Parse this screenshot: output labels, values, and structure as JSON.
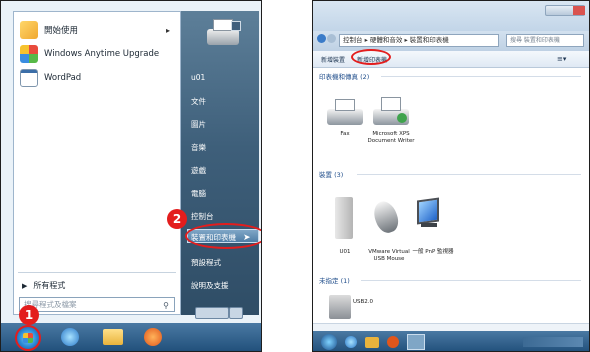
{
  "start_menu": {
    "programs": [
      {
        "label": "開始使用",
        "has_arrow": true,
        "icon": "getting-started-icon"
      },
      {
        "label": "Windows Anytime Upgrade",
        "has_arrow": false,
        "icon": "windows-upgrade-icon"
      },
      {
        "label": "WordPad",
        "has_arrow": false,
        "icon": "wordpad-icon"
      }
    ],
    "all_programs": "所有程式",
    "search_placeholder": "搜尋程式及檔案",
    "right_items": [
      "u01",
      "文件",
      "圖片",
      "音樂",
      "遊戲",
      "電腦",
      "控制台",
      "裝置和印表機",
      "預設程式",
      "說明及支援"
    ],
    "highlighted_item": "裝置和印表機"
  },
  "callouts": {
    "step1": "1",
    "step2": "2"
  },
  "devices_window": {
    "address": "控制台 ▸ 硬體和音效 ▸ 裝置和印表機",
    "search_placeholder": "搜尋 裝置和印表機",
    "commands": [
      "新增裝置",
      "新增印表機"
    ],
    "sections": {
      "printers": "印表機和傳真 (2)",
      "devices": "裝置 (3)",
      "unspecified": "未指定 (1)"
    },
    "printers": [
      {
        "label": "Fax"
      },
      {
        "label": "Microsoft XPS Document Writer"
      }
    ],
    "devices": [
      {
        "label": "U01"
      },
      {
        "label": "VMware Virtual USB Mouse"
      },
      {
        "label": "一般 PnP 監視器"
      }
    ],
    "unspecified_device": {
      "label": "USB2.0"
    }
  },
  "colors": {
    "highlight": "#e31d1d",
    "sidebar": "#3e5f7a",
    "taskbar": "#1f4e79"
  }
}
